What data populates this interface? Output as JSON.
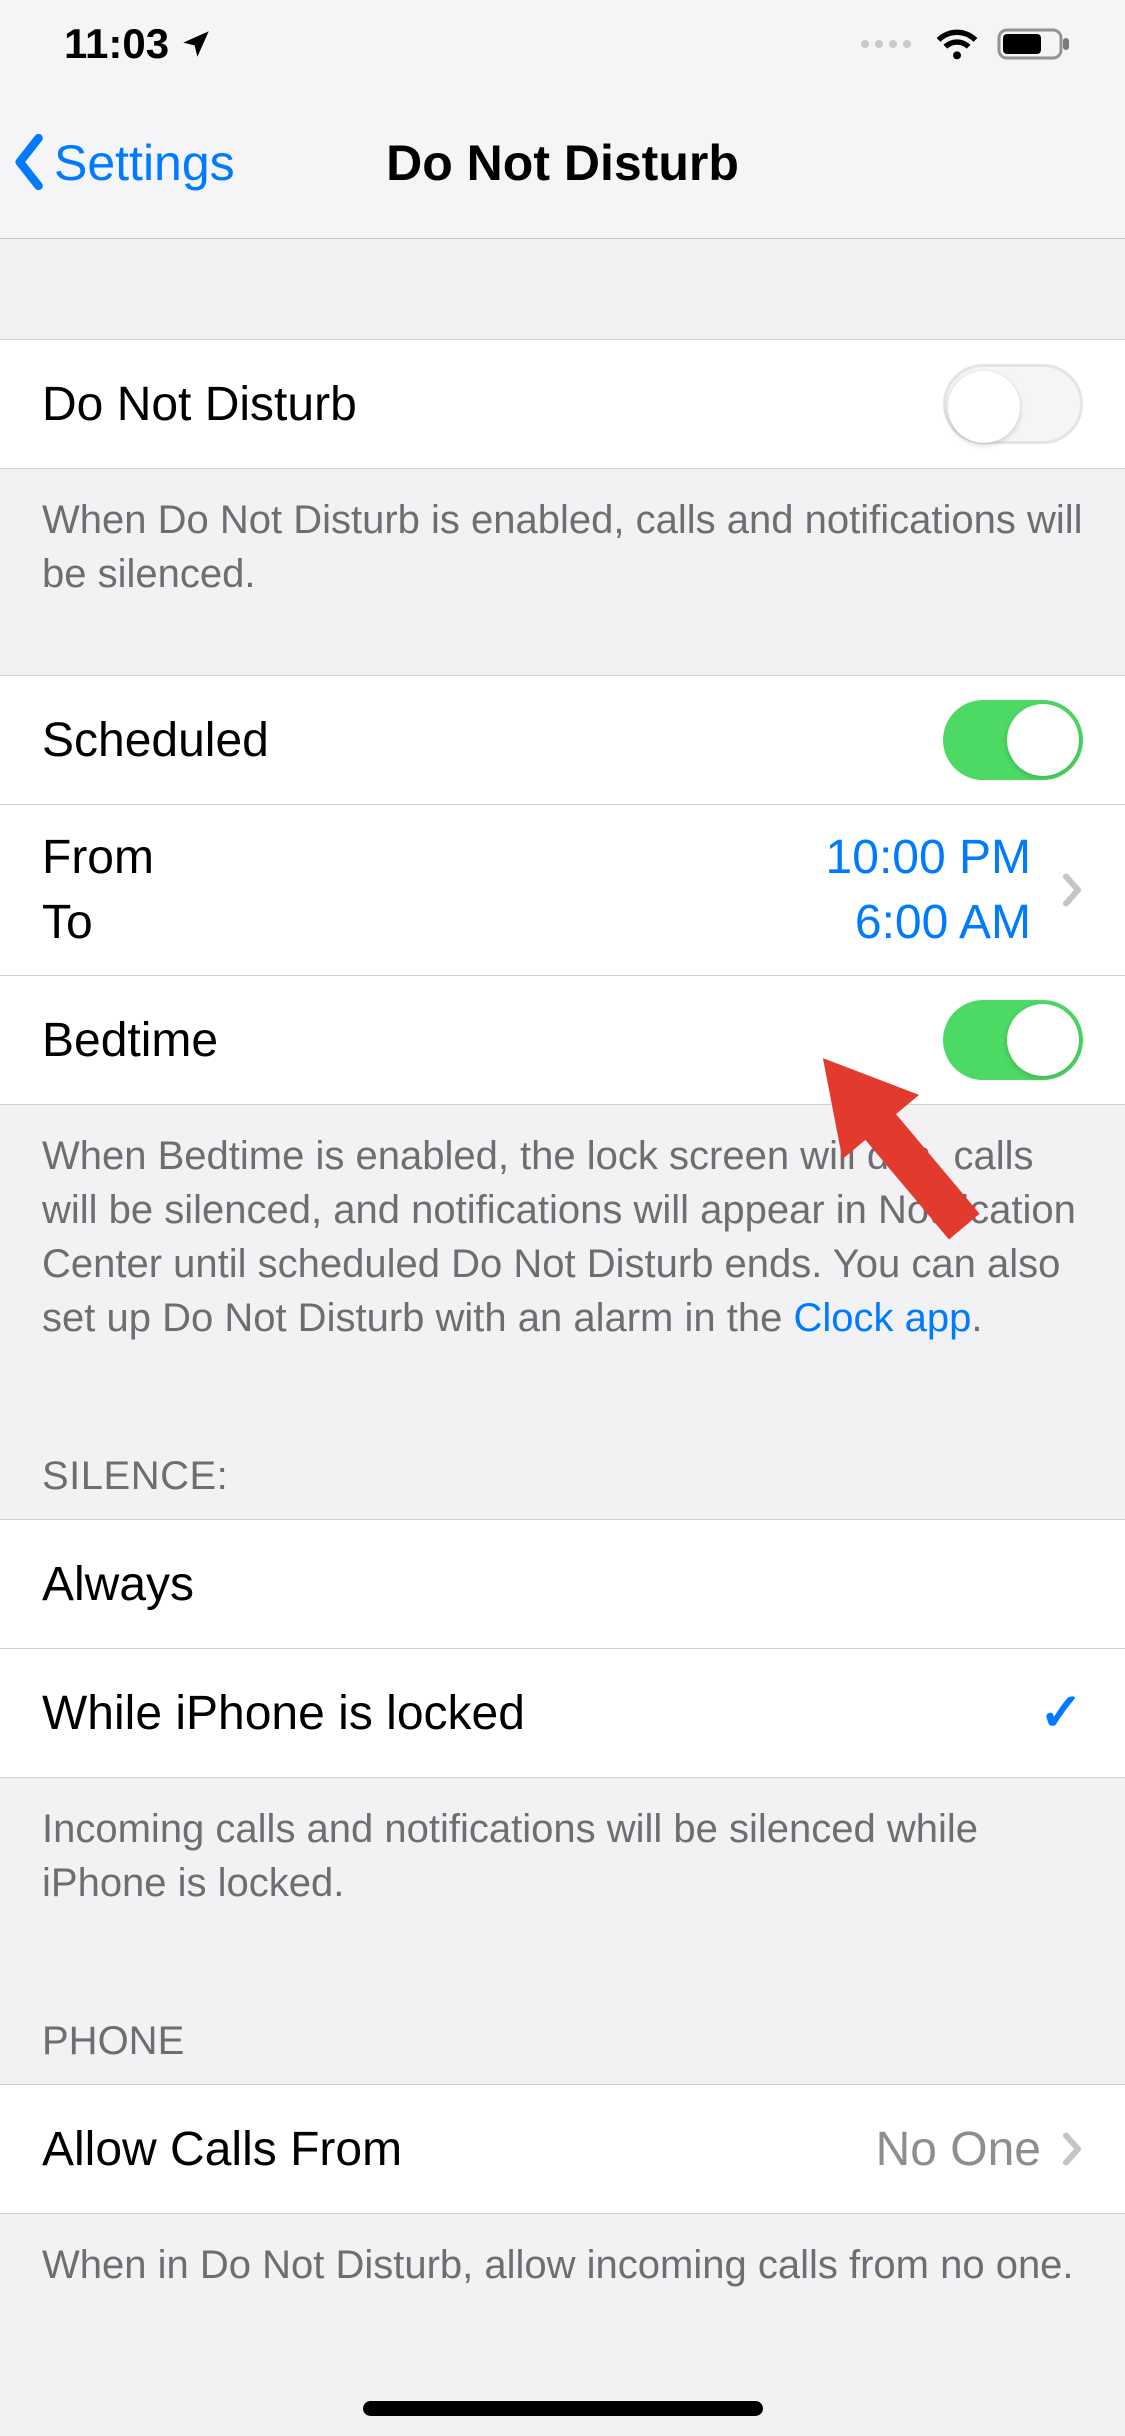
{
  "status": {
    "time": "11:03"
  },
  "nav": {
    "back_label": "Settings",
    "title": "Do Not Disturb"
  },
  "dnd": {
    "toggle_label": "Do Not Disturb",
    "footer": "When Do Not Disturb is enabled, calls and notifications will be silenced."
  },
  "scheduled": {
    "toggle_label": "Scheduled",
    "from_label": "From",
    "to_label": "To",
    "from_value": "10:00 PM",
    "to_value": "6:00 AM"
  },
  "bedtime": {
    "toggle_label": "Bedtime",
    "footer_before": "When Bedtime is enabled, the lock screen will dim, calls will be silenced, and notifications will appear in Notification Center until scheduled Do Not Disturb ends. You can also set up Do Not Disturb with an alarm in the ",
    "clock_link": "Clock app",
    "footer_after": "."
  },
  "silence": {
    "header": "SILENCE:",
    "option_always": "Always",
    "option_locked": "While iPhone is locked",
    "footer": "Incoming calls and notifications will be silenced while iPhone is locked."
  },
  "phone": {
    "header": "PHONE",
    "allow_label": "Allow Calls From",
    "allow_value": "No One",
    "footer": "When in Do Not Disturb, allow incoming calls from no one."
  }
}
